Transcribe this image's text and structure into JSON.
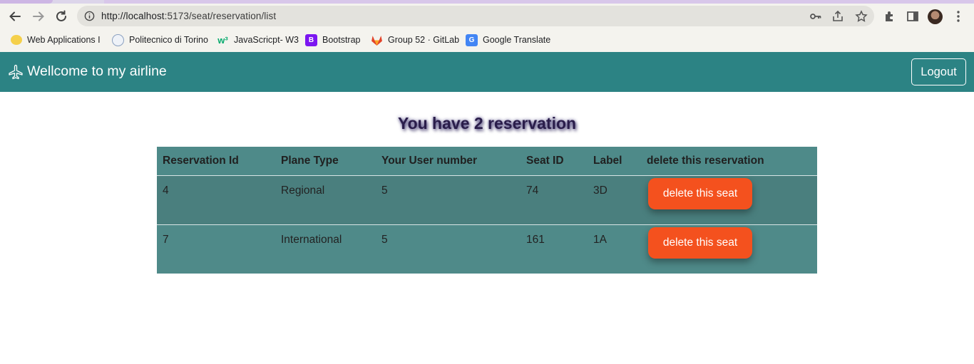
{
  "browser": {
    "url_host": "http://localhost",
    "url_rest": ":5173/seat/reservation/list",
    "bookmarks": [
      {
        "label": "Web Applications I",
        "icon": "chat-icon"
      },
      {
        "label": "Politecnico di Torino",
        "icon": "polito-icon"
      },
      {
        "label": "JavaScricpt- W3",
        "icon": "w3-icon"
      },
      {
        "label": "Bootstrap",
        "icon": "bootstrap-icon"
      },
      {
        "label": "Group 52 · GitLab",
        "icon": "gitlab-icon"
      },
      {
        "label": "Google Translate",
        "icon": "translate-icon"
      }
    ]
  },
  "navbar": {
    "brand": "Wellcome to my airline",
    "logout_label": "Logout"
  },
  "main": {
    "heading": "You have 2 reservation",
    "columns": [
      "Reservation Id",
      "Plane Type",
      "Your User number",
      "Seat ID",
      "Label",
      "delete this reservation"
    ],
    "rows": [
      {
        "id": "4",
        "plane": "Regional",
        "user": "5",
        "seat": "74",
        "label": "3D",
        "action": "delete this seat"
      },
      {
        "id": "7",
        "plane": "International",
        "user": "5",
        "seat": "161",
        "label": "1A",
        "action": "delete this seat"
      }
    ]
  },
  "colors": {
    "navbar": "#2c8384",
    "table": "#4e8a89",
    "delete_button": "#f4511e"
  }
}
